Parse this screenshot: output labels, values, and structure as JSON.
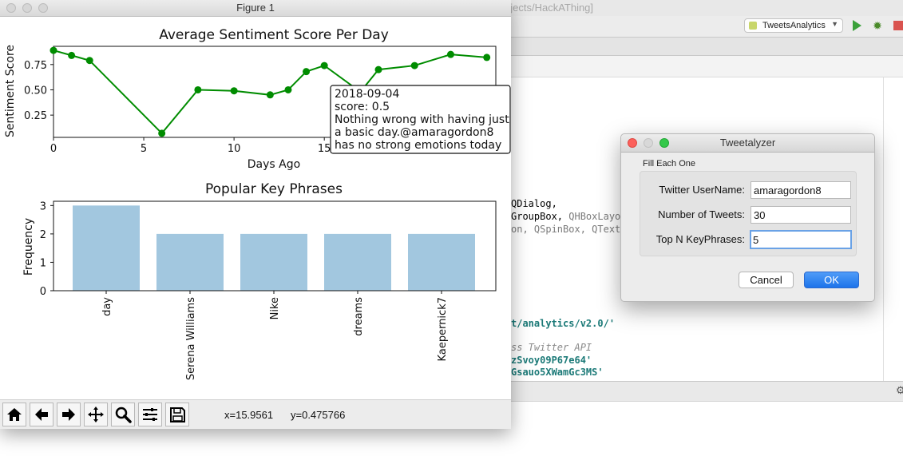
{
  "ide": {
    "path_fragment": "ojects/HackAThing]",
    "run_config": "TweetsAnalytics",
    "code_lines": [
      {
        "parts": [
          {
            "t": "QDialog,",
            "c": "kw"
          }
        ]
      },
      {
        "parts": [
          {
            "t": "GroupBox, ",
            "c": "kw"
          },
          {
            "t": "QHBoxLayou",
            "c": "gray"
          }
        ]
      },
      {
        "parts": [
          {
            "t": "on, QSpinBox, QTextE",
            "c": "gray"
          }
        ]
      },
      {
        "parts": [
          {
            "t": "t/analytics/v2.0/'",
            "c": "str"
          }
        ]
      },
      {
        "parts": [
          {
            "t": "ss Twitter API",
            "c": "comment"
          }
        ]
      },
      {
        "parts": [
          {
            "t": "zSvoy09P67e64'",
            "c": "str"
          }
        ]
      },
      {
        "parts": [
          {
            "t": "Gsauo5XWamGc3MS'",
            "c": "str"
          }
        ]
      }
    ]
  },
  "figure": {
    "window_title": "Figure 1",
    "coords": {
      "x": "x=15.9561",
      "y": "y=0.475766"
    },
    "toolbar": [
      "home-icon",
      "back-icon",
      "forward-icon",
      "pan-icon",
      "zoom-icon",
      "configure-icon",
      "save-icon"
    ],
    "annotation": {
      "lines": [
        "2018-09-04",
        "score: 0.5",
        "Nothing wrong with having just",
        "a basic day.@amaragordon8",
        "has no strong emotions today"
      ]
    }
  },
  "chart_data": [
    {
      "type": "line",
      "title": "Average Sentiment Score Per Day",
      "xlabel": "Days Ago",
      "ylabel": "Sentiment Score",
      "x": [
        0,
        1,
        2,
        6,
        8,
        10,
        12,
        13,
        14,
        15,
        17,
        18,
        20,
        22,
        24
      ],
      "y": [
        0.89,
        0.84,
        0.79,
        0.07,
        0.5,
        0.49,
        0.45,
        0.5,
        0.68,
        0.74,
        0.48,
        0.7,
        0.74,
        0.85,
        0.82
      ],
      "xlim": [
        0,
        24.5
      ],
      "ylim": [
        0.03,
        0.93
      ],
      "xticks": [
        0,
        5,
        10,
        15
      ],
      "yticks": [
        0.25,
        0.5,
        0.75
      ],
      "color": "#008c00"
    },
    {
      "type": "bar",
      "title": "Popular Key Phrases",
      "ylabel": "Frequency",
      "categories": [
        "day",
        "Serena Williams",
        "Nike",
        "dreams",
        "Kaepernick7"
      ],
      "values": [
        3,
        2,
        2,
        2,
        2
      ],
      "ylim": [
        0,
        3.15
      ],
      "yticks": [
        0,
        1,
        2,
        3
      ],
      "color": "#a2c7df"
    }
  ],
  "dialog": {
    "title": "Tweetalyzer",
    "group_title": "Fill Each One",
    "fields": [
      {
        "label": "Twitter UserName:",
        "value": "amaragordon8"
      },
      {
        "label": "Number of Tweets:",
        "value": "30"
      },
      {
        "label": "Top N KeyPhrases:",
        "value": "5"
      }
    ],
    "cancel_label": "Cancel",
    "ok_label": "OK"
  }
}
